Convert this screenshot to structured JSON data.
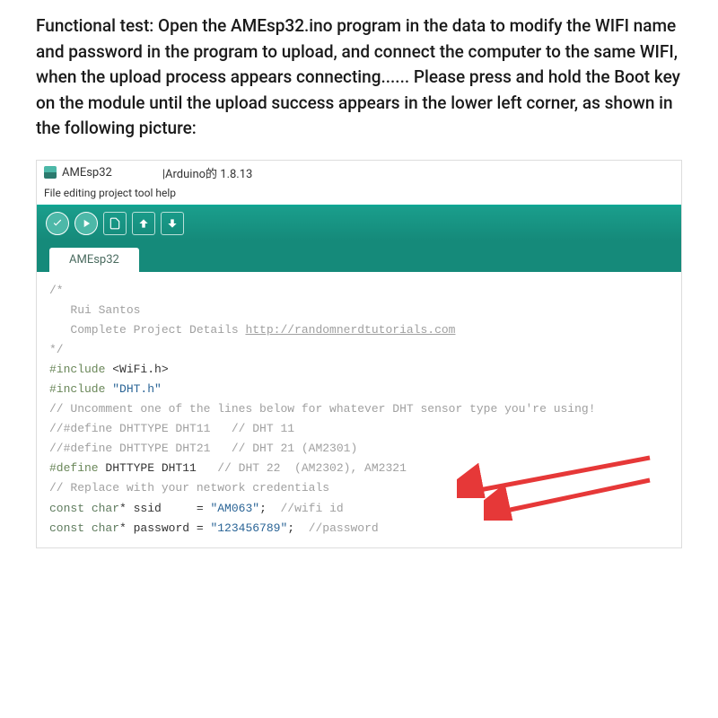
{
  "instruction": "Functional test: Open the AMEsp32.ino program in the data to modify the WIFI name and password in the program to upload, and connect the computer to the same WIFI, when the upload process appears connecting...... Please press and hold the Boot key on the module until the upload success appears in the lower left corner, as shown in the following picture:",
  "ide": {
    "title": {
      "project": "AMEsp32",
      "version": "|Arduino的 1.8.13"
    },
    "menu": "File editing project tool help",
    "tab": "AMEsp32"
  },
  "code": {
    "line1": "/*",
    "line2": "   Rui Santos",
    "line3_prefix": "   Complete Project Details ",
    "line3_link": "http://randomnerdtutorials.com",
    "line4": "*/",
    "line5": "",
    "line6a": "#include ",
    "line6b": "<WiFi.h>",
    "line7a": "#include ",
    "line7b": "\"DHT.h\"",
    "line8": "",
    "line9": "// Uncomment one of the lines below for whatever DHT sensor type you're using!",
    "line10": "//#define DHTTYPE DHT11   // DHT 11",
    "line11": "//#define DHTTYPE DHT21   // DHT 21 (AM2301)",
    "line12a": "#define",
    "line12b": " DHTTYPE DHT11   ",
    "line12c": "// DHT 22  (AM2302), AM2321",
    "line13": "",
    "line14": "// Replace with your network credentials",
    "line15a": "const",
    "line15b": " char",
    "line15c": "* ssid     = ",
    "line15d": "\"AM063\"",
    "line15e": ";  ",
    "line15f": "//wifi id",
    "line16a": "const",
    "line16b": " char",
    "line16c": "* password = ",
    "line16d": "\"123456789\"",
    "line16e": ";  ",
    "line16f": "//password"
  }
}
